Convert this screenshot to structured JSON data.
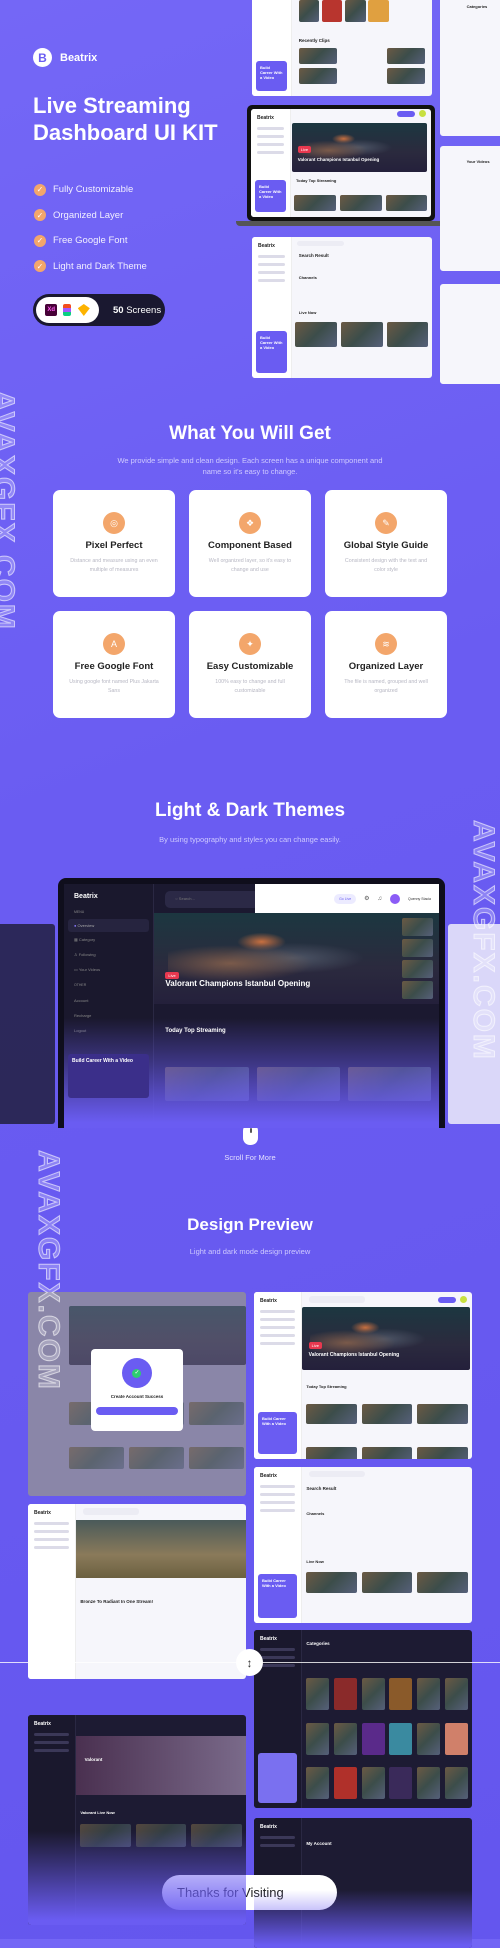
{
  "brand": {
    "name": "Beatrix",
    "initial": "B"
  },
  "hero": {
    "title_line1": "Live Streaming",
    "title_line2": "Dashboard UI KIT",
    "features": [
      "Fully Customizable",
      "Organized Layer",
      "Free Google Font",
      "Light and Dark Theme"
    ],
    "tools": [
      "Xd",
      "Figma",
      "Sketch"
    ],
    "screens_count": "50",
    "screens_label": "Screens"
  },
  "mockups": {
    "stream_title": "Valorant Champions Istanbul Opening",
    "live_badge": "Live",
    "today_top": "Today Top Streaming",
    "search_result": "Search Result",
    "channels": "Channels",
    "live_now": "Live Now",
    "recently_clips": "Recently Clips",
    "categories": "Categories",
    "your_videos": "Your Videos",
    "promo": "Build Career With a Video",
    "search_placeholder": "Search...",
    "go_live": "Go Live",
    "user_name": "Quenny Stacia",
    "create_account": "Create Account Success",
    "video_title": "Bronze To Radiant In One Stream!",
    "my_account": "My Account",
    "valorant": "Valorant",
    "valorant_live": "Valorant Live Now",
    "menu": [
      "Overview",
      "Category",
      "Following",
      "Your Videos"
    ],
    "other_label": "OTHER",
    "menu_label": "MENU",
    "other": [
      "Account",
      "Recharge",
      "Logout"
    ]
  },
  "what_you_get": {
    "title": "What You Will Get",
    "subtitle": "We provide simple and clean design. Each screen has a unique component and name so it's easy to change.",
    "cards": [
      {
        "icon": "pixel-icon",
        "title": "Pixel Perfect",
        "desc": "Distance and measure using an even multiple of measures"
      },
      {
        "icon": "component-icon",
        "title": "Component Based",
        "desc": "Well organized layer, so it's easy to change and use"
      },
      {
        "icon": "style-guide-icon",
        "title": "Global Style Guide",
        "desc": "Consistent design with the text and color style"
      },
      {
        "icon": "font-icon",
        "title": "Free Google Font",
        "desc": "Using google font named Plus Jakarta Sans"
      },
      {
        "icon": "customize-icon",
        "title": "Easy Customizable",
        "desc": "100% easy to change and full customizable"
      },
      {
        "icon": "layers-icon",
        "title": "Organized Layer",
        "desc": "The file is named, grouped and well organized"
      }
    ]
  },
  "themes": {
    "title": "Light & Dark Themes",
    "subtitle": "By using typography and styles you can change easily.",
    "scroll": "Scroll For More"
  },
  "preview": {
    "title": "Design Preview",
    "subtitle": "Light and dark mode design preview"
  },
  "thanks": "Thanks for Visiting",
  "watermark": "AVAXGFX.COM",
  "colors": {
    "background": "#6a5cf2",
    "accent": "#f3a66b",
    "dark": "#1a1830",
    "live": "#e8384f"
  }
}
